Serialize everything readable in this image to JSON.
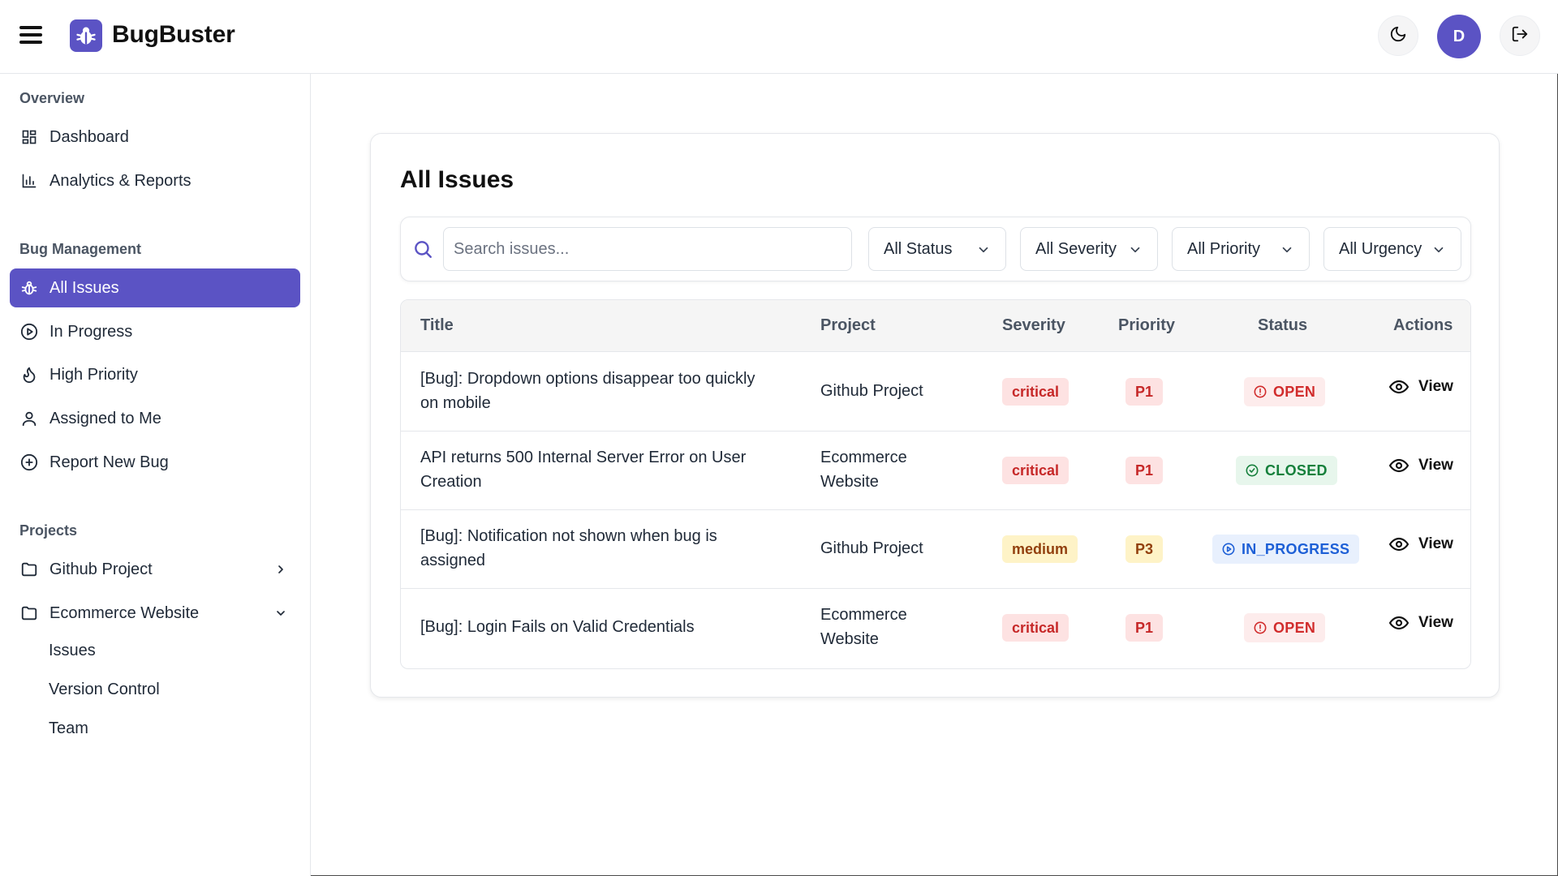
{
  "app": {
    "name": "BugBuster"
  },
  "header": {
    "avatar_initial": "D"
  },
  "sidebar": {
    "sections": [
      {
        "label": "Overview"
      },
      {
        "label": "Bug Management"
      },
      {
        "label": "Projects"
      }
    ],
    "overview_items": [
      {
        "label": "Dashboard",
        "icon": "dashboard-icon"
      },
      {
        "label": "Analytics & Reports",
        "icon": "bar-chart-icon"
      }
    ],
    "bug_items": [
      {
        "label": "All Issues",
        "icon": "bug-icon",
        "active": true
      },
      {
        "label": "In Progress",
        "icon": "play-circle-icon"
      },
      {
        "label": "High Priority",
        "icon": "flame-icon"
      },
      {
        "label": "Assigned to Me",
        "icon": "user-icon"
      },
      {
        "label": "Report New Bug",
        "icon": "plus-circle-icon"
      }
    ],
    "projects": [
      {
        "label": "Github Project",
        "expanded": false
      },
      {
        "label": "Ecommerce Website",
        "expanded": true
      }
    ],
    "project_subitems": [
      {
        "label": "Issues"
      },
      {
        "label": "Version Control"
      },
      {
        "label": "Team"
      }
    ]
  },
  "main": {
    "title": "All Issues",
    "search": {
      "placeholder": "Search issues...",
      "value": ""
    },
    "filters": [
      {
        "label": "All Status"
      },
      {
        "label": "All Severity"
      },
      {
        "label": "All Priority"
      },
      {
        "label": "All Urgency"
      }
    ],
    "columns": [
      "Title",
      "Project",
      "Severity",
      "Priority",
      "Status",
      "Actions"
    ],
    "issues": [
      {
        "title_line1": "[Bug]: Dropdown options disappear too quickly",
        "title_line2": "on mobile",
        "project_line1": "Github Project",
        "project_line2": "",
        "severity": "critical",
        "priority": "P1",
        "status": "OPEN",
        "action": "View"
      },
      {
        "title_line1": "API returns 500 Internal Server Error on User",
        "title_line2": "Creation",
        "project_line1": "Ecommerce",
        "project_line2": "Website",
        "severity": "critical",
        "priority": "P1",
        "status": "CLOSED",
        "action": "View"
      },
      {
        "title_line1": "[Bug]: Notification not shown when bug is",
        "title_line2": "assigned",
        "project_line1": "Github Project",
        "project_line2": "",
        "severity": "medium",
        "priority": "P3",
        "status": "IN_PROGRESS",
        "action": "View"
      },
      {
        "title_line1": "[Bug]: Login Fails on Valid Credentials",
        "title_line2": "",
        "project_line1": "Ecommerce",
        "project_line2": "Website",
        "severity": "critical",
        "priority": "P1",
        "status": "OPEN",
        "action": "View"
      }
    ]
  },
  "colors": {
    "accent": "#5b53c4",
    "critical": "#c62828",
    "medium": "#92400e",
    "open": "#d12c2c",
    "closed": "#16803c",
    "in_progress": "#1d5fd6"
  }
}
